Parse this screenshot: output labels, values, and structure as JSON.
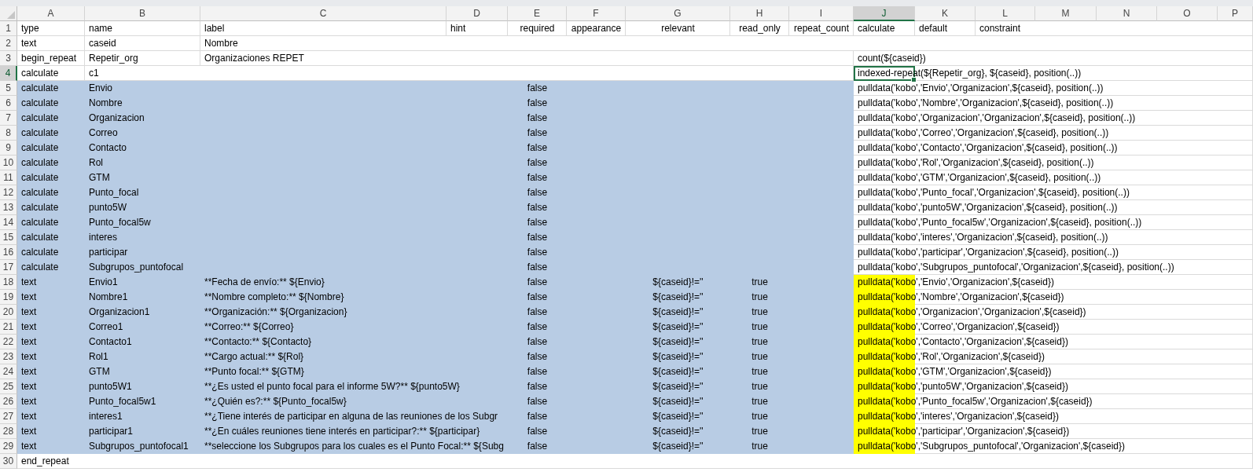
{
  "sheet": {
    "columns": [
      {
        "label": "A",
        "selected": false
      },
      {
        "label": "B",
        "selected": false
      },
      {
        "label": "C",
        "selected": false
      },
      {
        "label": "D",
        "selected": false
      },
      {
        "label": "E",
        "selected": false
      },
      {
        "label": "F",
        "selected": false
      },
      {
        "label": "G",
        "selected": false
      },
      {
        "label": "H",
        "selected": false
      },
      {
        "label": "I",
        "selected": false
      },
      {
        "label": "J",
        "selected": true
      },
      {
        "label": "K",
        "selected": false
      },
      {
        "label": "L",
        "selected": false
      },
      {
        "label": "M",
        "selected": false
      },
      {
        "label": "N",
        "selected": false
      },
      {
        "label": "O",
        "selected": false
      },
      {
        "label": "P",
        "selected": false
      }
    ],
    "rows": [
      {
        "number": "1",
        "current": false,
        "selected": false,
        "highlighted": false,
        "cells": [
          "type",
          "name",
          "label",
          "hint",
          "required",
          "appearance",
          "relevant",
          "read_only",
          "repeat_count",
          "calculate",
          "default",
          "constraint"
        ]
      },
      {
        "number": "2",
        "current": false,
        "selected": false,
        "highlighted": false,
        "cells": [
          "text",
          "caseid",
          "Nombre"
        ]
      },
      {
        "number": "3",
        "current": false,
        "selected": false,
        "highlighted": false,
        "cells": [
          "begin_repeat",
          "Repetir_org",
          "Organizaciones REPET",
          null,
          null,
          null,
          null,
          null,
          null,
          "count(${caseid})"
        ]
      },
      {
        "number": "4",
        "current": true,
        "selected": false,
        "highlighted": false,
        "cells": [
          "calculate",
          "c1",
          null,
          null,
          null,
          null,
          null,
          null,
          null,
          "indexed-repeat(${Repetir_org}, ${caseid}, position(..))"
        ]
      },
      {
        "number": "5",
        "current": false,
        "selected": true,
        "highlighted": false,
        "cells": [
          "calculate",
          "Envio",
          null,
          null,
          "false",
          null,
          null,
          null,
          null,
          "pulldata('kobo','Envio','Organizacion',${caseid}, position(..))"
        ]
      },
      {
        "number": "6",
        "current": false,
        "selected": true,
        "highlighted": false,
        "cells": [
          "calculate",
          "Nombre",
          null,
          null,
          "false",
          null,
          null,
          null,
          null,
          "pulldata('kobo','Nombre','Organizacion',${caseid}, position(..))"
        ]
      },
      {
        "number": "7",
        "current": false,
        "selected": true,
        "highlighted": false,
        "cells": [
          "calculate",
          "Organizacion",
          null,
          null,
          "false",
          null,
          null,
          null,
          null,
          "pulldata('kobo','Organizacion','Organizacion',${caseid}, position(..))"
        ]
      },
      {
        "number": "8",
        "current": false,
        "selected": true,
        "highlighted": false,
        "cells": [
          "calculate",
          "Correo",
          null,
          null,
          "false",
          null,
          null,
          null,
          null,
          "pulldata('kobo','Correo','Organizacion',${caseid}, position(..))"
        ]
      },
      {
        "number": "9",
        "current": false,
        "selected": true,
        "highlighted": false,
        "cells": [
          "calculate",
          "Contacto",
          null,
          null,
          "false",
          null,
          null,
          null,
          null,
          "pulldata('kobo','Contacto','Organizacion',${caseid}, position(..))"
        ]
      },
      {
        "number": "10",
        "current": false,
        "selected": true,
        "highlighted": false,
        "cells": [
          "calculate",
          "Rol",
          null,
          null,
          "false",
          null,
          null,
          null,
          null,
          "pulldata('kobo','Rol','Organizacion',${caseid}, position(..))"
        ]
      },
      {
        "number": "11",
        "current": false,
        "selected": true,
        "highlighted": false,
        "cells": [
          "calculate",
          "GTM",
          null,
          null,
          "false",
          null,
          null,
          null,
          null,
          "pulldata('kobo','GTM','Organizacion',${caseid}, position(..))"
        ]
      },
      {
        "number": "12",
        "current": false,
        "selected": true,
        "highlighted": false,
        "cells": [
          "calculate",
          "Punto_focal",
          null,
          null,
          "false",
          null,
          null,
          null,
          null,
          "pulldata('kobo','Punto_focal','Organizacion',${caseid}, position(..))"
        ]
      },
      {
        "number": "13",
        "current": false,
        "selected": true,
        "highlighted": false,
        "cells": [
          "calculate",
          "punto5W",
          null,
          null,
          "false",
          null,
          null,
          null,
          null,
          "pulldata('kobo','punto5W','Organizacion',${caseid}, position(..))"
        ]
      },
      {
        "number": "14",
        "current": false,
        "selected": true,
        "highlighted": false,
        "cells": [
          "calculate",
          "Punto_focal5w",
          null,
          null,
          "false",
          null,
          null,
          null,
          null,
          "pulldata('kobo','Punto_focal5w','Organizacion',${caseid}, position(..))"
        ]
      },
      {
        "number": "15",
        "current": false,
        "selected": true,
        "highlighted": false,
        "cells": [
          "calculate",
          "interes",
          null,
          null,
          "false",
          null,
          null,
          null,
          null,
          "pulldata('kobo','interes','Organizacion',${caseid}, position(..))"
        ]
      },
      {
        "number": "16",
        "current": false,
        "selected": true,
        "highlighted": false,
        "cells": [
          "calculate",
          "participar",
          null,
          null,
          "false",
          null,
          null,
          null,
          null,
          "pulldata('kobo','participar','Organizacion',${caseid}, position(..))"
        ]
      },
      {
        "number": "17",
        "current": false,
        "selected": true,
        "highlighted": false,
        "cells": [
          "calculate",
          "Subgrupos_puntofocal",
          null,
          null,
          "false",
          null,
          null,
          null,
          null,
          "pulldata('kobo','Subgrupos_puntofocal','Organizacion',${caseid}, position(..))"
        ]
      },
      {
        "number": "18",
        "current": false,
        "selected": true,
        "highlighted": true,
        "cells": [
          "text",
          "Envio1",
          "**Fecha de envío:** ${Envio}",
          null,
          "false",
          null,
          "${caseid}!=''",
          "true",
          null,
          "pulldata('kobo','Envio','Organizacion',${caseid})"
        ]
      },
      {
        "number": "19",
        "current": false,
        "selected": true,
        "highlighted": true,
        "cells": [
          "text",
          "Nombre1",
          "**Nombre completo:** ${Nombre}",
          null,
          "false",
          null,
          "${caseid}!=''",
          "true",
          null,
          "pulldata('kobo','Nombre','Organizacion',${caseid})"
        ]
      },
      {
        "number": "20",
        "current": false,
        "selected": true,
        "highlighted": true,
        "cells": [
          "text",
          "Organizacion1",
          "**Organización:** ${Organizacion}",
          null,
          "false",
          null,
          "${caseid}!=''",
          "true",
          null,
          "pulldata('kobo','Organizacion','Organizacion',${caseid})"
        ]
      },
      {
        "number": "21",
        "current": false,
        "selected": true,
        "highlighted": true,
        "cells": [
          "text",
          "Correo1",
          "**Correo:** ${Correo}",
          null,
          "false",
          null,
          "${caseid}!=''",
          "true",
          null,
          "pulldata('kobo','Correo','Organizacion',${caseid})"
        ]
      },
      {
        "number": "22",
        "current": false,
        "selected": true,
        "highlighted": true,
        "cells": [
          "text",
          "Contacto1",
          "**Contacto:** ${Contacto}",
          null,
          "false",
          null,
          "${caseid}!=''",
          "true",
          null,
          "pulldata('kobo','Contacto','Organizacion',${caseid})"
        ]
      },
      {
        "number": "23",
        "current": false,
        "selected": true,
        "highlighted": true,
        "cells": [
          "text",
          "Rol1",
          "**Cargo actual:** ${Rol}",
          null,
          "false",
          null,
          "${caseid}!=''",
          "true",
          null,
          "pulldata('kobo','Rol','Organizacion',${caseid})"
        ]
      },
      {
        "number": "24",
        "current": false,
        "selected": true,
        "highlighted": true,
        "cells": [
          "text",
          "GTM",
          "**Punto focal:** ${GTM}",
          null,
          "false",
          null,
          "${caseid}!=''",
          "true",
          null,
          "pulldata('kobo','GTM','Organizacion',${caseid})"
        ]
      },
      {
        "number": "25",
        "current": false,
        "selected": true,
        "highlighted": true,
        "cells": [
          "text",
          "punto5W1",
          "**¿Es usted el punto focal para el informe 5W?** ${punto5W}",
          null,
          "false",
          null,
          "${caseid}!=''",
          "true",
          null,
          "pulldata('kobo','punto5W','Organizacion',${caseid})"
        ]
      },
      {
        "number": "26",
        "current": false,
        "selected": true,
        "highlighted": true,
        "cells": [
          "text",
          "Punto_focal5w1",
          "**¿Quién es?:** ${Punto_focal5w}",
          null,
          "false",
          null,
          "${caseid}!=''",
          "true",
          null,
          "pulldata('kobo','Punto_focal5w','Organizacion',${caseid})"
        ]
      },
      {
        "number": "27",
        "current": false,
        "selected": true,
        "highlighted": true,
        "cells": [
          "text",
          "interes1",
          "**¿Tiene interés de participar en alguna de las reuniones de los Subgr",
          null,
          "false",
          null,
          "${caseid}!=''",
          "true",
          null,
          "pulldata('kobo','interes','Organizacion',${caseid})"
        ]
      },
      {
        "number": "28",
        "current": false,
        "selected": true,
        "highlighted": true,
        "cells": [
          "text",
          "participar1",
          "**¿En cuáles reuniones tiene interés en participar?:** ${participar}",
          null,
          "false",
          null,
          "${caseid}!=''",
          "true",
          null,
          "pulldata('kobo','participar','Organizacion',${caseid})"
        ]
      },
      {
        "number": "29",
        "current": false,
        "selected": true,
        "highlighted": true,
        "cells": [
          "text",
          "Subgrupos_puntofocal1",
          "**seleccione los Subgrupos para los cuales es el Punto Focal:** ${Subg",
          null,
          "false",
          null,
          "${caseid}!=''",
          "true",
          null,
          "pulldata('kobo','Subgrupos_puntofocal','Organizacion',${caseid})"
        ]
      },
      {
        "number": "30",
        "current": false,
        "selected": false,
        "highlighted": false,
        "cells": [
          "end_repeat"
        ]
      }
    ]
  }
}
